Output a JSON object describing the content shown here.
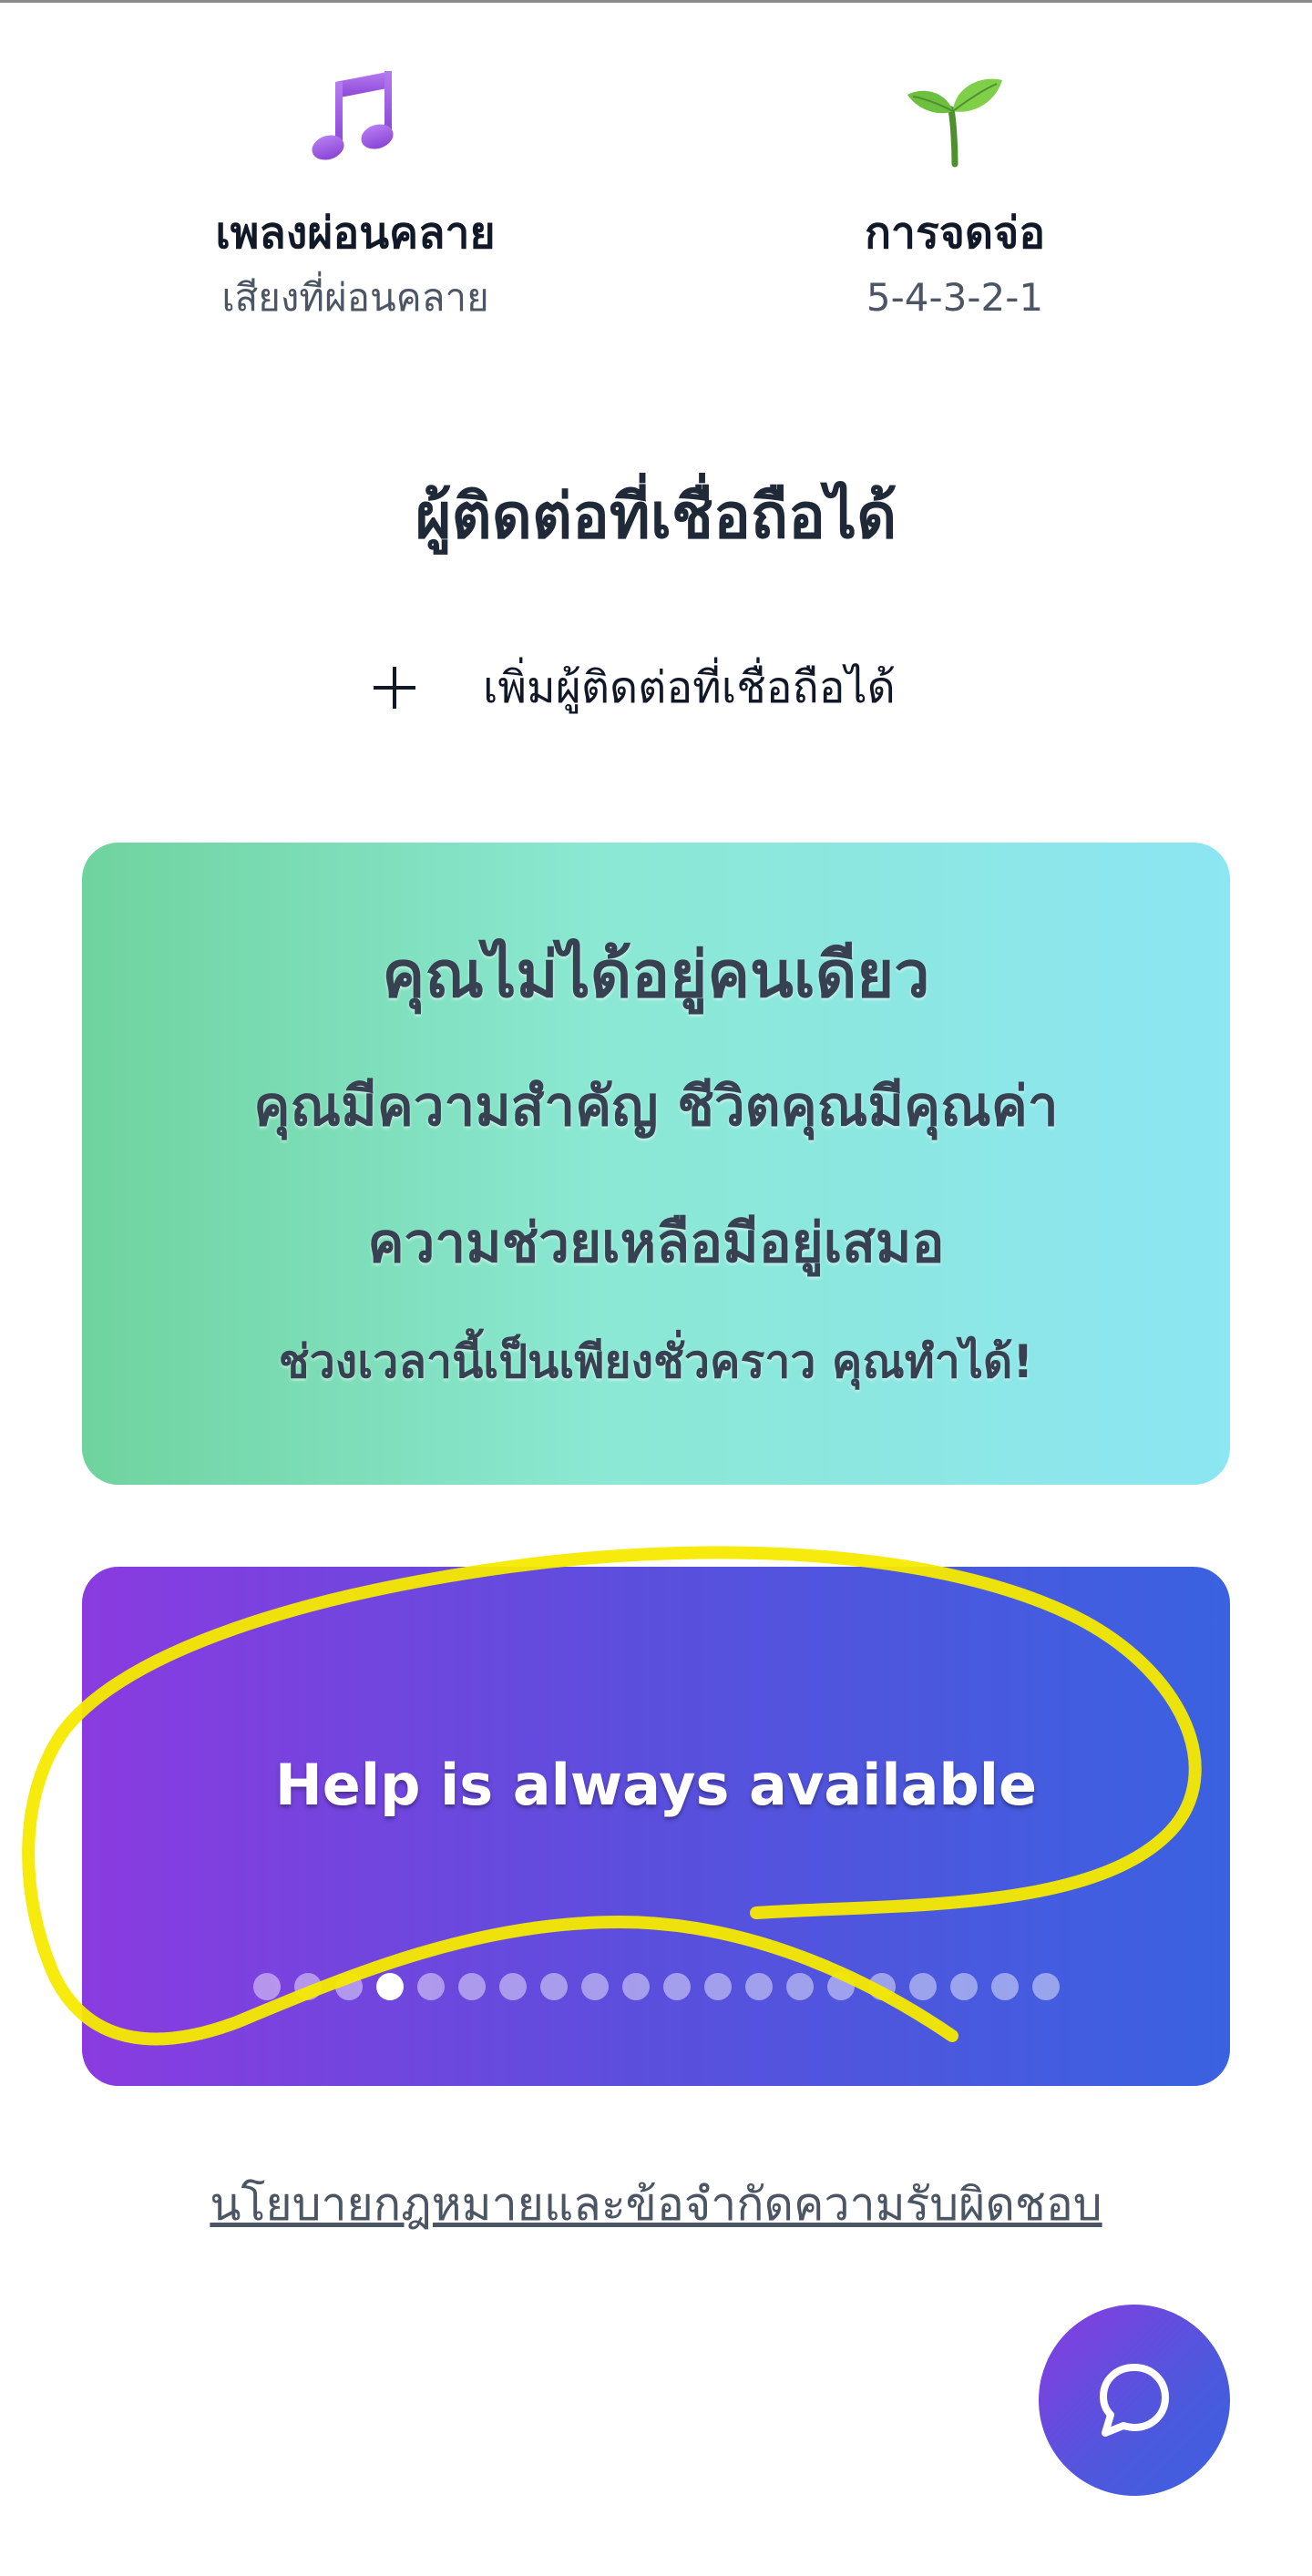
{
  "tools": {
    "music": {
      "icon": "music-notes-icon",
      "title": "เพลงผ่อนคลาย",
      "subtitle": "เสียงที่ผ่อนคลาย"
    },
    "grounding": {
      "icon": "seedling-icon",
      "title": "การจดจ่อ",
      "subtitle": "5-4-3-2-1"
    }
  },
  "trusted_contacts": {
    "title": "ผู้ติดต่อที่เชื่อถือได้",
    "add_label": "เพิ่มผู้ติดต่อที่เชื่อถือได้",
    "add_icon": "plus-icon"
  },
  "support_card": {
    "line1": "คุณไม่ได้อยู่คนเดียว",
    "line2": "คุณมีความสำคัญ ชีวิตคุณมีคุณค่า",
    "line3": "ความช่วยเหลือมีอยู่เสมอ",
    "line4": "ช่วงเวลานี้เป็นเพียงชั่วคราว คุณทำได้!"
  },
  "carousel": {
    "text": "Help is always available",
    "dot_count": 20,
    "active_index": 3
  },
  "footer": {
    "legal_link": "นโยบายกฎหมายและข้อจำกัดความรับผิดชอบ"
  },
  "chat_button": {
    "icon": "chat-bubble-icon"
  },
  "colors": {
    "support_gradient": [
      "#6fd39e",
      "#8ce6f3"
    ],
    "carousel_gradient": [
      "#8a3be0",
      "#3a62e0"
    ],
    "scribble": "#f5ea00"
  }
}
